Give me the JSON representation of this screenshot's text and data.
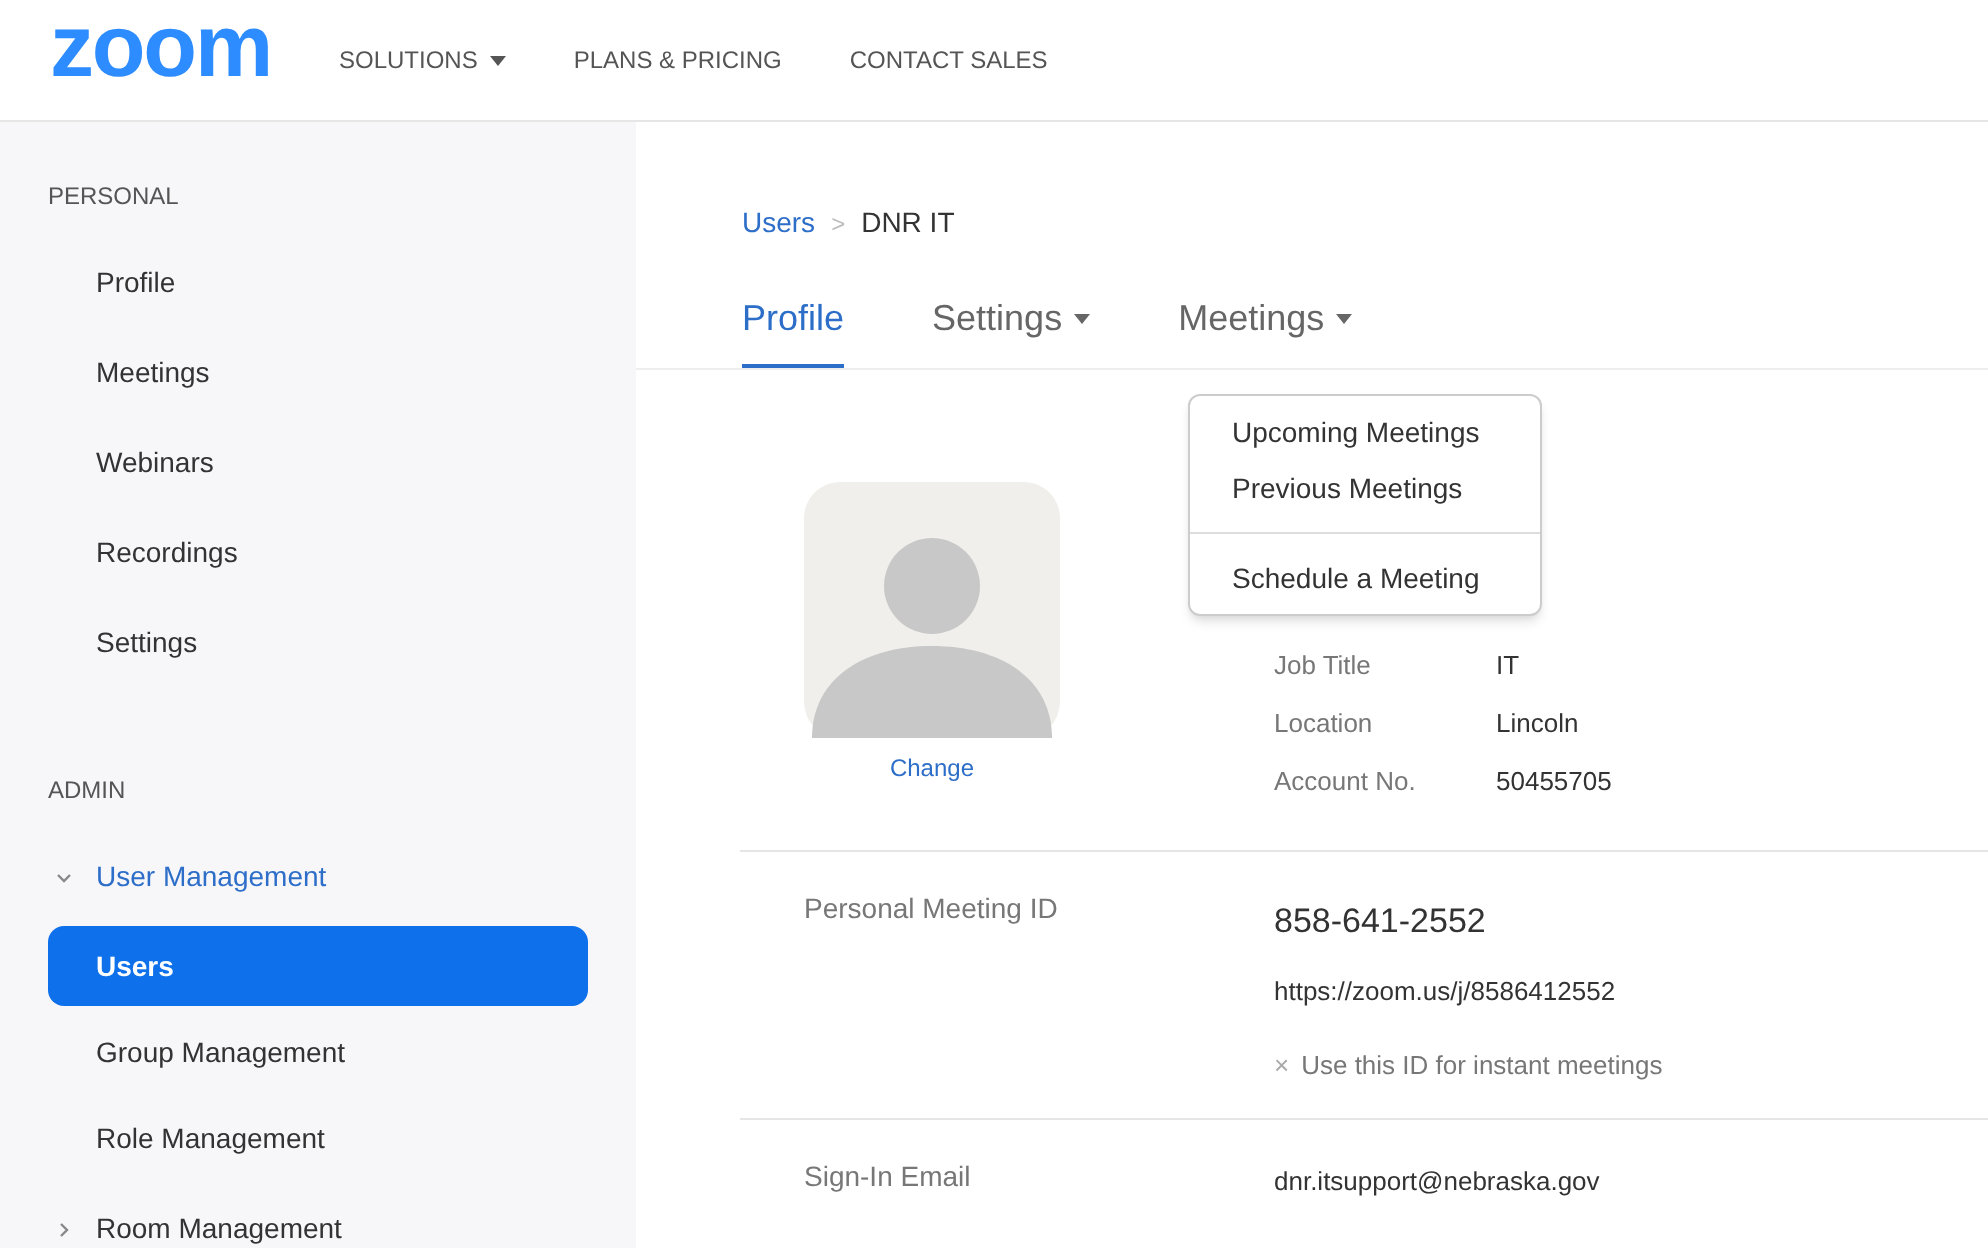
{
  "header": {
    "logo": "zoom",
    "nav": [
      {
        "label": "SOLUTIONS",
        "has_menu": true
      },
      {
        "label": "PLANS & PRICING",
        "has_menu": false
      },
      {
        "label": "CONTACT SALES",
        "has_menu": false
      }
    ]
  },
  "sidebar": {
    "sections": [
      {
        "title": "PERSONAL",
        "items": [
          {
            "label": "Profile",
            "selected": false
          },
          {
            "label": "Meetings",
            "selected": false
          },
          {
            "label": "Webinars",
            "selected": false
          },
          {
            "label": "Recordings",
            "selected": false
          },
          {
            "label": "Settings",
            "selected": false
          }
        ]
      },
      {
        "title": "ADMIN",
        "items": [
          {
            "label": "User Management",
            "selected": false,
            "expanded": true,
            "children": [
              {
                "label": "Users",
                "selected": true
              },
              {
                "label": "Group Management",
                "selected": false
              },
              {
                "label": "Role Management",
                "selected": false
              }
            ]
          },
          {
            "label": "Room Management",
            "selected": false,
            "expanded": false
          }
        ]
      }
    ]
  },
  "breadcrumb": {
    "items": [
      "Users",
      "DNR IT"
    ],
    "separator": ">"
  },
  "tabs": [
    {
      "label": "Profile",
      "selected": true,
      "has_menu": false
    },
    {
      "label": "Settings",
      "selected": false,
      "has_menu": true
    },
    {
      "label": "Meetings",
      "selected": false,
      "has_menu": true
    }
  ],
  "meetings_menu": {
    "groups": [
      [
        "Upcoming Meetings",
        "Previous Meetings"
      ],
      [
        "Schedule a Meeting"
      ]
    ]
  },
  "profile": {
    "change_link": "Change",
    "details": [
      {
        "label": "Job Title",
        "value": "IT"
      },
      {
        "label": "Location",
        "value": "Lincoln"
      },
      {
        "label": "Account No.",
        "value": "50455705"
      }
    ]
  },
  "personal_meeting_id": {
    "label": "Personal Meeting ID",
    "id": "858-641-2552",
    "url": "https://zoom.us/j/8586412552",
    "instant_option": {
      "label": "Use this ID for instant meetings",
      "checked": false,
      "icon": "×"
    }
  },
  "sign_in_email": {
    "label": "Sign-In Email",
    "value": "dnr.itsupport@nebraska.gov"
  }
}
